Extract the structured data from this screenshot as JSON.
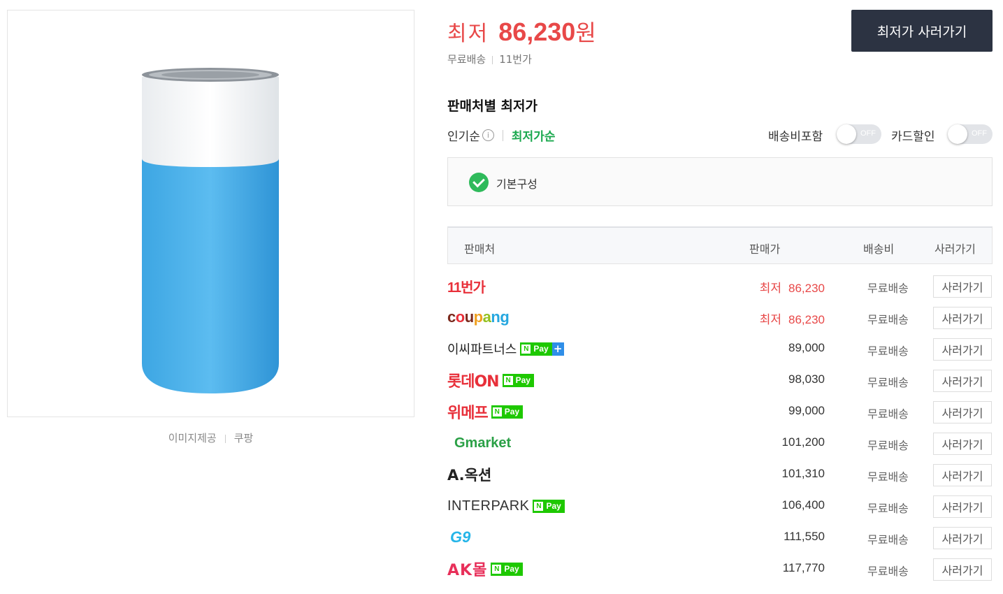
{
  "product_image": {
    "credit_label": "이미지제공",
    "credit_source": "쿠팡"
  },
  "price_summary": {
    "label": "최저",
    "price": "86,230",
    "unit": "원",
    "shipping": "무료배송",
    "store": "11번가",
    "buy_button": "최저가 사러가기"
  },
  "seller_section": {
    "title": "판매처별 최저가",
    "sort_popular": "인기순",
    "sort_lowest": "최저가순",
    "toggle_shipping_label": "배송비포함",
    "toggle_shipping_state": "OFF",
    "toggle_card_label": "카드할인",
    "toggle_card_state": "OFF",
    "option_label": "기본구성"
  },
  "table": {
    "headers": {
      "seller": "판매처",
      "price": "판매가",
      "shipping": "배송비",
      "buy": "사러가기"
    },
    "rows": [
      {
        "seller": "11번가",
        "price_prefix": "최저",
        "price": "86,230",
        "shipping": "무료배송",
        "buy": "사러가기"
      },
      {
        "seller": "coupang",
        "price_prefix": "최저",
        "price": "86,230",
        "shipping": "무료배송",
        "buy": "사러가기"
      },
      {
        "seller": "이씨파트너스",
        "price": "89,000",
        "shipping": "무료배송",
        "buy": "사러가기",
        "npay": "Pay"
      },
      {
        "seller": "롯데ON",
        "price": "98,030",
        "shipping": "무료배송",
        "buy": "사러가기",
        "npay": "Pay"
      },
      {
        "seller": "위메프",
        "price": "99,000",
        "shipping": "무료배송",
        "buy": "사러가기",
        "npay": "Pay"
      },
      {
        "seller": "Gmarket",
        "price": "101,200",
        "shipping": "무료배송",
        "buy": "사러가기"
      },
      {
        "seller": "A.옥션",
        "price": "101,310",
        "shipping": "무료배송",
        "buy": "사러가기"
      },
      {
        "seller": "INTERPARK",
        "price": "106,400",
        "shipping": "무료배송",
        "buy": "사러가기",
        "npay": "Pay"
      },
      {
        "seller": "G9",
        "price": "111,550",
        "shipping": "무료배송",
        "buy": "사러가기"
      },
      {
        "seller": "AK몰",
        "price": "117,770",
        "shipping": "무료배송",
        "buy": "사러가기",
        "npay": "Pay"
      }
    ]
  },
  "colors": {
    "accent_red": "#e84848",
    "green": "#1aa84e",
    "button_dark": "#2c3342",
    "npay_green": "#1ec800"
  }
}
